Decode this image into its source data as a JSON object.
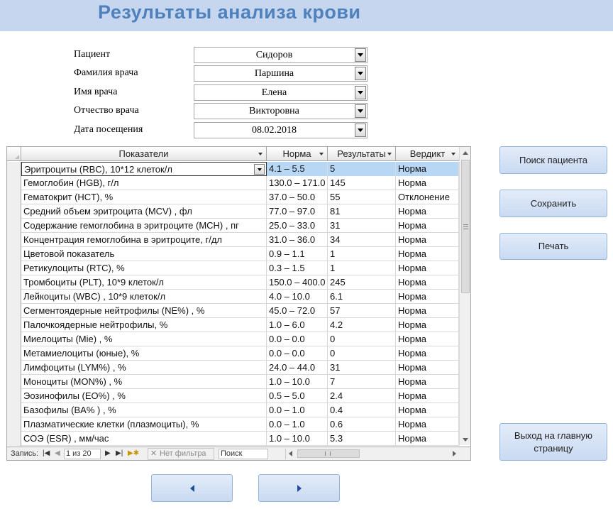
{
  "header": {
    "title": "Результаты анализа крови",
    "bg_color": "#c6d6ee",
    "title_color": "#4f81bd"
  },
  "form": {
    "patient": {
      "label": "Пациент",
      "value": "Сидоров"
    },
    "doctor_last": {
      "label": "Фамилия врача",
      "value": "Паршина"
    },
    "doctor_first": {
      "label": "Имя врача",
      "value": "Елена"
    },
    "doctor_middle": {
      "label": "Отчество врача",
      "value": "Викторовна"
    },
    "visit_date": {
      "label": "Дата посещения",
      "value": "08.02.2018"
    }
  },
  "grid": {
    "columns": [
      "Показатели",
      "Норма",
      "Результаты",
      "Вердикт"
    ],
    "rows": [
      [
        "Эритроциты (RBC), 10*12 клеток/л",
        "4.1 – 5.5",
        "5",
        "Норма"
      ],
      [
        "Гемоглобин (HGB), г/л",
        "130.0 – 171.0",
        "145",
        "Норма"
      ],
      [
        "Гематокрит (HCT), %",
        "37.0 – 50.0",
        "55",
        "Отклонение"
      ],
      [
        "Средний объем эритроцита (MCV) , фл",
        "77.0 – 97.0",
        "81",
        "Норма"
      ],
      [
        "Содержание гемоглобина в эритроците (MCH) , пг",
        "25.0 – 33.0",
        "31",
        "Норма"
      ],
      [
        "Концентрация гемоглобина в эритроците, г/дл",
        "31.0 – 36.0",
        "34",
        "Норма"
      ],
      [
        "Цветовой показатель",
        "0.9 – 1.1",
        "1",
        "Норма"
      ],
      [
        "Ретикулоциты (RTC), %",
        "0.3 – 1.5",
        "1",
        "Норма"
      ],
      [
        "Тромбоциты (PLT), 10*9 клеток/л",
        "150.0 – 400.0",
        "245",
        "Норма"
      ],
      [
        "Лейкоциты (WBC) , 10*9 клеток/л",
        "4.0 – 10.0",
        "6.1",
        "Норма"
      ],
      [
        "Сегментоядерные нейтрофилы (NE%) , %",
        "45.0 – 72.0",
        "57",
        "Норма"
      ],
      [
        "Палочкоядерные нейтрофилы, %",
        "1.0 – 6.0",
        "4.2",
        "Норма"
      ],
      [
        "Миелоциты (Mie) , %",
        "0.0 – 0.0",
        "0",
        "Норма"
      ],
      [
        "Метамиелоциты (юные), %",
        "0.0 – 0.0",
        "0",
        "Норма"
      ],
      [
        "Лимфоциты (LYM%) , %",
        "24.0 – 44.0",
        "31",
        "Норма"
      ],
      [
        "Моноциты (MON%) , %",
        "1.0 – 10.0",
        "7",
        "Норма"
      ],
      [
        "Эозинофилы (EO%) , %",
        "0.5 – 5.0",
        "2.4",
        "Норма"
      ],
      [
        "Базофилы (BA% ) , %",
        "0.0 – 1.0",
        "0.4",
        "Норма"
      ],
      [
        "Плазматические клетки (плазмоциты), %",
        "0.0 – 1.0",
        "0.6",
        "Норма"
      ],
      [
        "СОЭ (ESR) , мм/час",
        "1.0 – 10.0",
        "5.3",
        "Норма"
      ]
    ],
    "selected_highlight_color": "#b8d7f5"
  },
  "navigation": {
    "record_label": "Запись:",
    "counter": "1 из 20",
    "filter_label": "Нет фильтра",
    "search_value": "Поиск"
  },
  "buttons": {
    "find_patient": "Поиск пациента",
    "save": "Сохранить",
    "print": "Печать",
    "exit": "Выход на главную страницу",
    "accent_color": "#c9daf2"
  },
  "icons": {
    "first_record": "first-record-icon",
    "prev_record": "prev-record-icon",
    "next_record": "next-record-icon",
    "last_record": "last-record-icon",
    "new_record": "new-record-icon",
    "filter": "filter-off-icon",
    "back": "back-arrow-icon",
    "forward": "forward-arrow-icon"
  }
}
